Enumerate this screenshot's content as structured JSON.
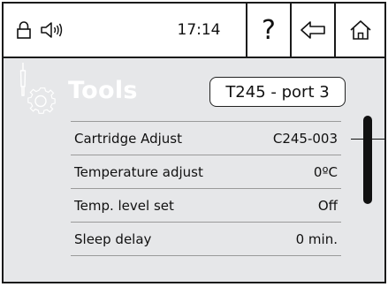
{
  "status_bar": {
    "lock_icon": "lock-icon",
    "speaker_icon": "speaker-icon",
    "time": "17:14",
    "help_label": "?",
    "back_icon": "back-arrow-icon",
    "home_icon": "home-icon"
  },
  "header": {
    "title": "Tools",
    "port_label": "T245 - port 3"
  },
  "menu": {
    "items": [
      {
        "label": "Cartridge Adjust",
        "value": "C245-003"
      },
      {
        "label": "Temperature adjust",
        "value": "0ºC"
      },
      {
        "label": "Temp. level set",
        "value": "Off"
      },
      {
        "label": "Sleep delay",
        "value": "0 min."
      }
    ]
  },
  "colors": {
    "background": "#e6e7e9",
    "status_bar_bg": "#ffffff",
    "title_text": "#ffffff",
    "border": "#1a1a1a"
  }
}
